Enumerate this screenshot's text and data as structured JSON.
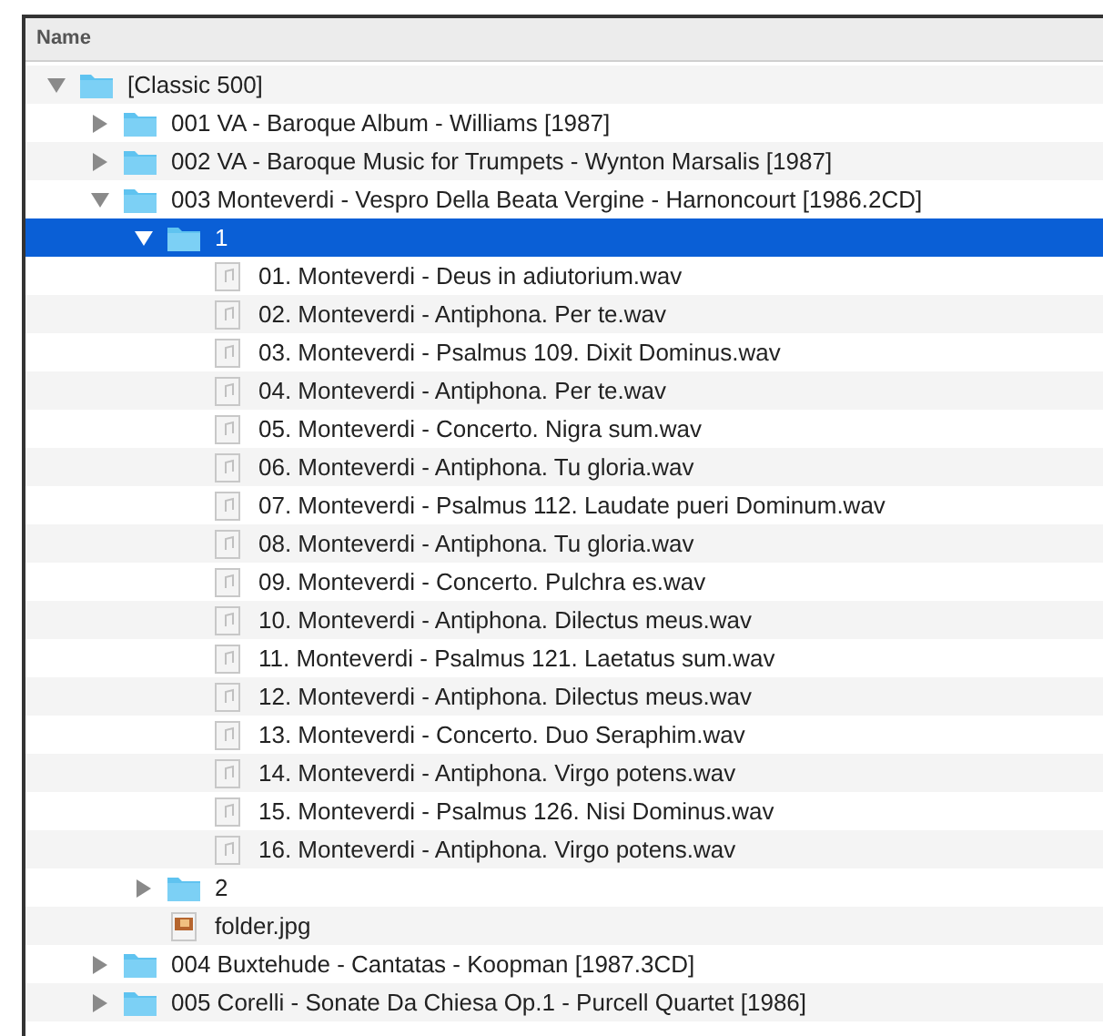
{
  "header": {
    "column": "Name"
  },
  "tree": [
    {
      "kind": "folder",
      "label": "[Classic 500]",
      "expanded": true,
      "selected": false,
      "children": [
        {
          "kind": "folder",
          "label": "001 VA - Baroque Album - Williams [1987]",
          "expanded": false,
          "selected": false
        },
        {
          "kind": "folder",
          "label": "002 VA - Baroque Music for Trumpets - Wynton Marsalis [1987]",
          "expanded": false,
          "selected": false
        },
        {
          "kind": "folder",
          "label": "003 Monteverdi - Vespro Della Beata Vergine - Harnoncourt [1986.2CD]",
          "expanded": true,
          "selected": false,
          "children": [
            {
              "kind": "folder",
              "label": "1",
              "expanded": true,
              "selected": true,
              "children": [
                {
                  "kind": "audio",
                  "label": "01. Monteverdi - Deus in adiutorium.wav",
                  "selected": false
                },
                {
                  "kind": "audio",
                  "label": "02. Monteverdi - Antiphona. Per te.wav",
                  "selected": false
                },
                {
                  "kind": "audio",
                  "label": "03. Monteverdi - Psalmus 109. Dixit Dominus.wav",
                  "selected": false
                },
                {
                  "kind": "audio",
                  "label": "04. Monteverdi - Antiphona. Per te.wav",
                  "selected": false
                },
                {
                  "kind": "audio",
                  "label": "05. Monteverdi - Concerto. Nigra sum.wav",
                  "selected": false
                },
                {
                  "kind": "audio",
                  "label": "06. Monteverdi - Antiphona. Tu gloria.wav",
                  "selected": false
                },
                {
                  "kind": "audio",
                  "label": "07. Monteverdi - Psalmus 112. Laudate pueri Dominum.wav",
                  "selected": false
                },
                {
                  "kind": "audio",
                  "label": "08. Monteverdi - Antiphona. Tu gloria.wav",
                  "selected": false
                },
                {
                  "kind": "audio",
                  "label": "09. Monteverdi - Concerto. Pulchra es.wav",
                  "selected": false
                },
                {
                  "kind": "audio",
                  "label": "10. Monteverdi - Antiphona. Dilectus meus.wav",
                  "selected": false
                },
                {
                  "kind": "audio",
                  "label": "11. Monteverdi - Psalmus 121. Laetatus sum.wav",
                  "selected": false
                },
                {
                  "kind": "audio",
                  "label": "12. Monteverdi - Antiphona. Dilectus meus.wav",
                  "selected": false
                },
                {
                  "kind": "audio",
                  "label": "13. Monteverdi - Concerto. Duo Seraphim.wav",
                  "selected": false
                },
                {
                  "kind": "audio",
                  "label": "14. Monteverdi - Antiphona. Virgo potens.wav",
                  "selected": false
                },
                {
                  "kind": "audio",
                  "label": "15. Monteverdi - Psalmus 126. Nisi Dominus.wav",
                  "selected": false
                },
                {
                  "kind": "audio",
                  "label": "16. Monteverdi - Antiphona. Virgo potens.wav",
                  "selected": false
                }
              ]
            },
            {
              "kind": "folder",
              "label": "2",
              "expanded": false,
              "selected": false
            },
            {
              "kind": "image",
              "label": "folder.jpg",
              "selected": false
            }
          ]
        },
        {
          "kind": "folder",
          "label": "004 Buxtehude - Cantatas - Koopman [1987.3CD]",
          "expanded": false,
          "selected": false
        },
        {
          "kind": "folder",
          "label": "005 Corelli - Sonate Da Chiesa Op.1 - Purcell Quartet [1986]",
          "expanded": false,
          "selected": false
        }
      ]
    }
  ]
}
